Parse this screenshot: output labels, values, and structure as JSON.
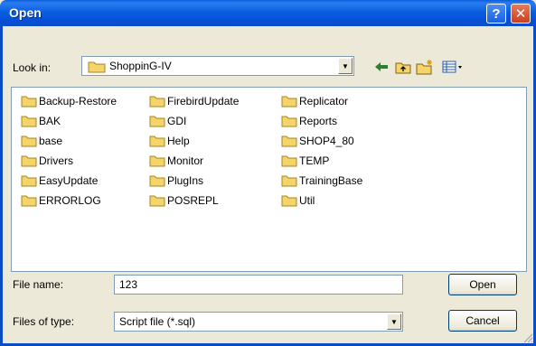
{
  "window": {
    "title": "Open",
    "help_label": "?",
    "close_label": "✕"
  },
  "toolbar": {
    "look_in_label": "Look in:",
    "look_in_value": "ShoppinG-IV"
  },
  "folders": [
    "Backup-Restore",
    "BAK",
    "base",
    "Drivers",
    "EasyUpdate",
    "ERRORLOG",
    "FirebirdUpdate",
    "GDI",
    "Help",
    "Monitor",
    "PlugIns",
    "POSREPL",
    "Replicator",
    "Reports",
    "SHOP4_80",
    "TEMP",
    "TrainingBase",
    "Util"
  ],
  "file_name": {
    "label": "File name:",
    "value": "123"
  },
  "file_type": {
    "label": "Files of type:",
    "value": "Script file (*.sql)"
  },
  "buttons": {
    "open": "Open",
    "cancel": "Cancel"
  },
  "colors": {
    "folder": "#f5d56a",
    "title_bar": "#0a5bdb",
    "dialog_bg": "#ece9d8"
  },
  "icons": [
    "back-icon",
    "up-folder-icon",
    "new-folder-icon",
    "view-menu-icon"
  ]
}
